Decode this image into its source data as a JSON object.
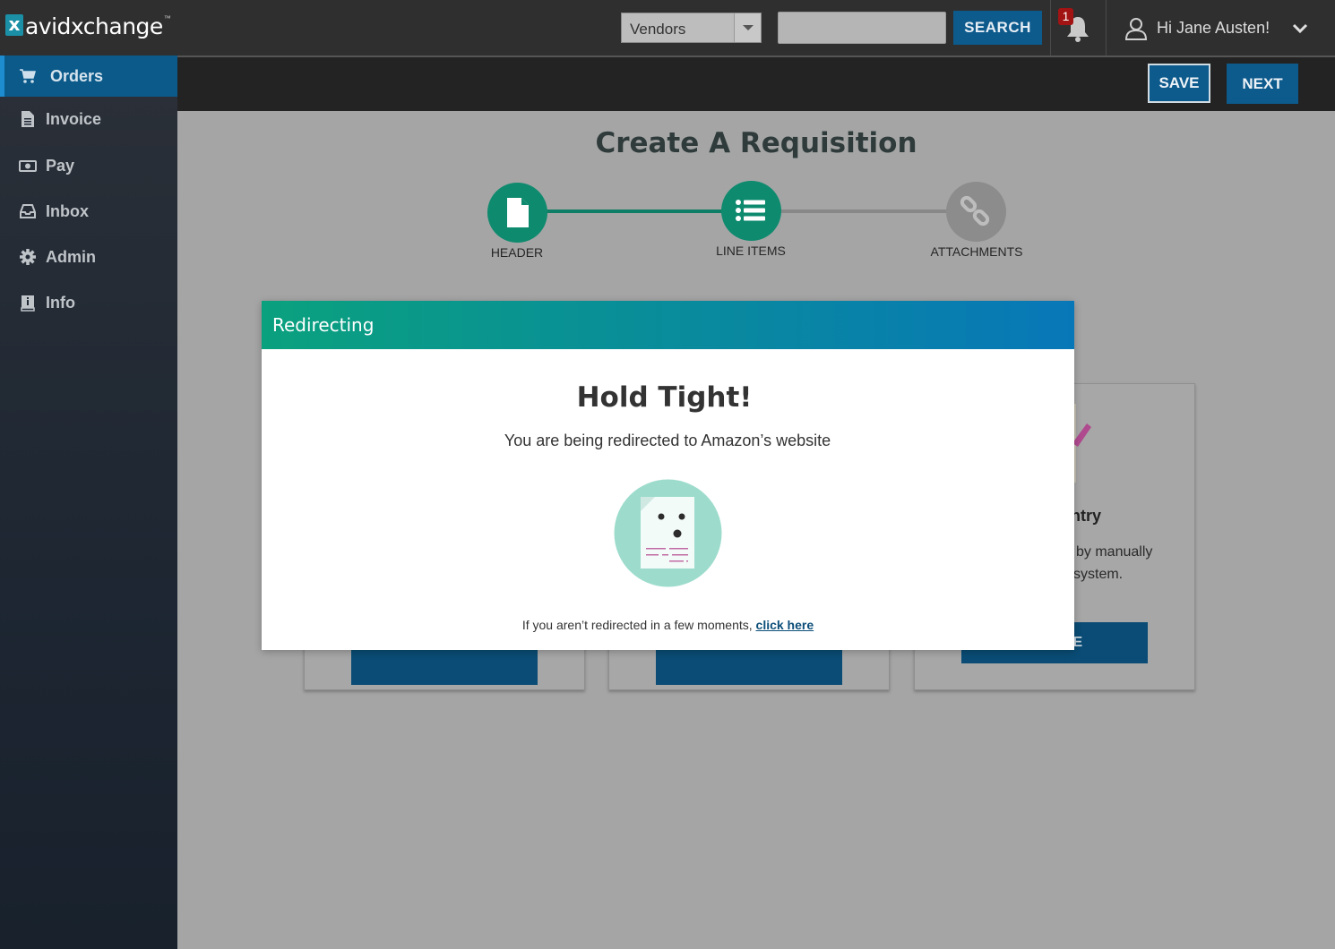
{
  "brand": {
    "logo_mark": "x",
    "logo_text": "avidxchange",
    "tm": "™"
  },
  "header": {
    "search_scope": "Vendors",
    "search_placeholder": "",
    "search_button": "SEARCH",
    "notification_count": "1",
    "greeting": "Hi Jane Austen!"
  },
  "sidebar": {
    "items": [
      {
        "label": "Orders",
        "icon": "cart-icon",
        "active": true
      },
      {
        "label": "Invoice",
        "icon": "document-icon",
        "active": false
      },
      {
        "label": "Pay",
        "icon": "money-icon",
        "active": false
      },
      {
        "label": "Inbox",
        "icon": "inbox-icon",
        "active": false
      },
      {
        "label": "Admin",
        "icon": "gear-icon",
        "active": false
      },
      {
        "label": "Info",
        "icon": "info-book-icon",
        "active": false
      }
    ]
  },
  "actions": {
    "save": "SAVE",
    "next": "NEXT"
  },
  "page": {
    "title": "Create A Requisition",
    "steps": [
      {
        "label": "HEADER",
        "icon": "document-icon",
        "state": "complete"
      },
      {
        "label": "LINE ITEMS",
        "icon": "list-icon",
        "state": "current"
      },
      {
        "label": "ATTACHMENTS",
        "icon": "link-icon",
        "state": "pending"
      }
    ],
    "cards": [
      {
        "title": "",
        "desc": "",
        "button": ""
      },
      {
        "title": "",
        "desc": "",
        "button": ""
      },
      {
        "title": "ntry",
        "desc_line1": "by manually",
        "desc_line2": "system.",
        "button": "IE"
      }
    ]
  },
  "modal": {
    "title": "Redirecting",
    "heading": "Hold Tight!",
    "message": "You are being redirected to Amazon’s website",
    "footer_text": "If you aren’t redirected in a few moments, ",
    "footer_link": "click here"
  },
  "colors": {
    "primary": "#0d5a8c",
    "success": "#0e8a6e",
    "pending": "#8c8c8c",
    "modal_gradient_start": "#0aa17e",
    "modal_gradient_end": "#0877b8"
  }
}
